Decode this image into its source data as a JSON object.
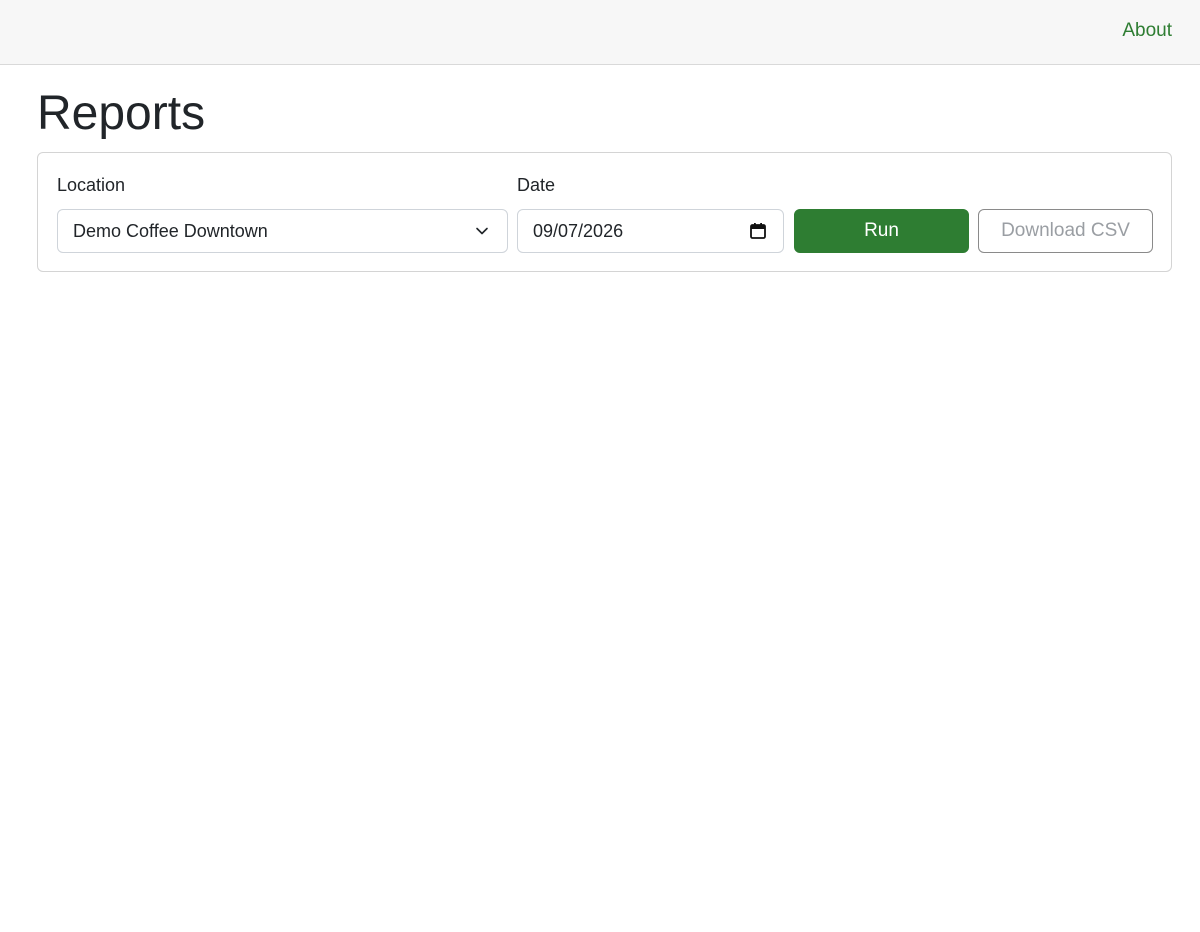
{
  "nav": {
    "about_label": "About"
  },
  "page": {
    "title": "Reports"
  },
  "filters": {
    "location_label": "Location",
    "location_value": "Demo Coffee Downtown",
    "date_label": "Date",
    "date_value": "09/07/2026"
  },
  "actions": {
    "run_label": "Run",
    "download_label": "Download CSV",
    "download_disabled": true
  },
  "colors": {
    "accent": "#2e7d32",
    "topbar_bg": "#f7f7f7"
  },
  "icons": {
    "select_icon": "chevron-down-icon",
    "date_icon": "calendar-icon"
  }
}
